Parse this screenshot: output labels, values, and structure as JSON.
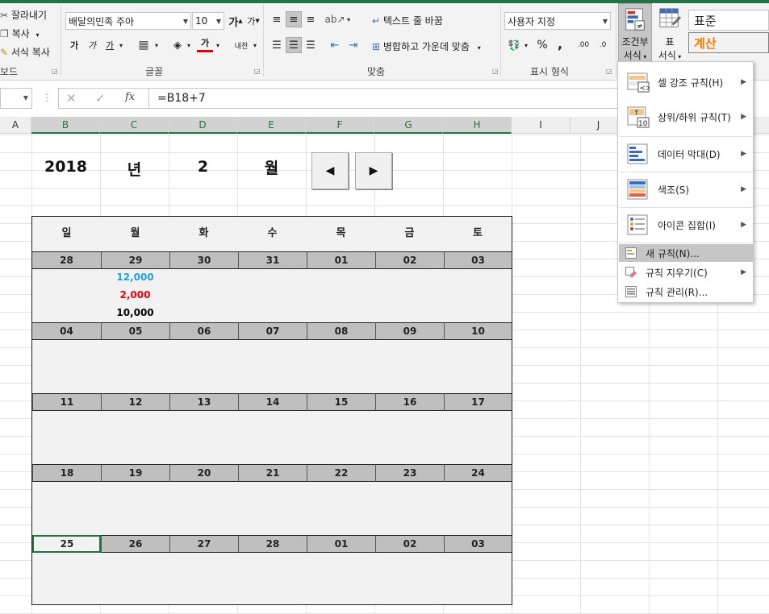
{
  "clipboard": {
    "cut": "잘라내기",
    "copy": "복사",
    "format_painter": "서식 복사",
    "group": "보드"
  },
  "font": {
    "name": "배달의민족 주아",
    "size": "10",
    "group": "글꼴",
    "grow": "가",
    "shrink": "가",
    "bold": "가",
    "italic": "가",
    "underline": "가",
    "font_color": "가",
    "phonetic": "내천"
  },
  "alignment": {
    "wrap_text": "텍스트 줄 바꿈",
    "merge_center": "병합하고 가운데 맞춤",
    "group": "맞춤"
  },
  "number": {
    "format": "사용자 지정",
    "percent": "%",
    "comma": ",",
    "inc_decimal": ".00",
    "dec_decimal": ".0",
    "group": "표시 형식"
  },
  "styles": {
    "conditional_format": "조건부",
    "conditional_format_2": "서식",
    "format_as_table": "표",
    "format_as_table_2": "서식",
    "style_normal": "표준",
    "style_calc": "계산"
  },
  "formula": {
    "value": "=B18+7",
    "cancel": "✕",
    "enter": "✓",
    "fx": "fx"
  },
  "columns": [
    "A",
    "B",
    "C",
    "D",
    "E",
    "F",
    "G",
    "H",
    "I",
    "J"
  ],
  "header": {
    "year": "2018",
    "year_suffix": "년",
    "month": "2",
    "month_suffix": "월",
    "prev": "◀",
    "next": "▶"
  },
  "weekdays": [
    "일",
    "월",
    "화",
    "수",
    "목",
    "금",
    "토"
  ],
  "weeks": [
    [
      "28",
      "29",
      "30",
      "31",
      "01",
      "02",
      "03"
    ],
    [
      "04",
      "05",
      "06",
      "07",
      "08",
      "09",
      "10"
    ],
    [
      "11",
      "12",
      "13",
      "14",
      "15",
      "16",
      "17"
    ],
    [
      "18",
      "19",
      "20",
      "21",
      "22",
      "23",
      "24"
    ],
    [
      "25",
      "26",
      "27",
      "28",
      "01",
      "02",
      "03"
    ]
  ],
  "amounts": [
    {
      "value": "12,000",
      "color": "#1ba1e2"
    },
    {
      "value": "2,000",
      "color": "#e8000b"
    },
    {
      "value": "10,000",
      "color": "#000000"
    }
  ],
  "menu": {
    "items": [
      {
        "label": "셀 강조 규칙(H)",
        "icon": "highlight-cells-rules-icon"
      },
      {
        "label": "상위/하위 규칙(T)",
        "icon": "top-bottom-rules-icon"
      },
      {
        "label": "데이터 막대(D)",
        "icon": "data-bars-icon"
      },
      {
        "label": "색조(S)",
        "icon": "color-scales-icon"
      },
      {
        "label": "아이콘 집합(I)",
        "icon": "icon-sets-icon"
      }
    ],
    "new_rule": "새 규칙(N)...",
    "clear_rules": "규칙 지우기(C)",
    "manage_rules": "규칙 관리(R)..."
  },
  "colors": {
    "accent": "#217346",
    "date_bar": "#bfbfbf",
    "calendar_bg": "#f2f2f2"
  }
}
